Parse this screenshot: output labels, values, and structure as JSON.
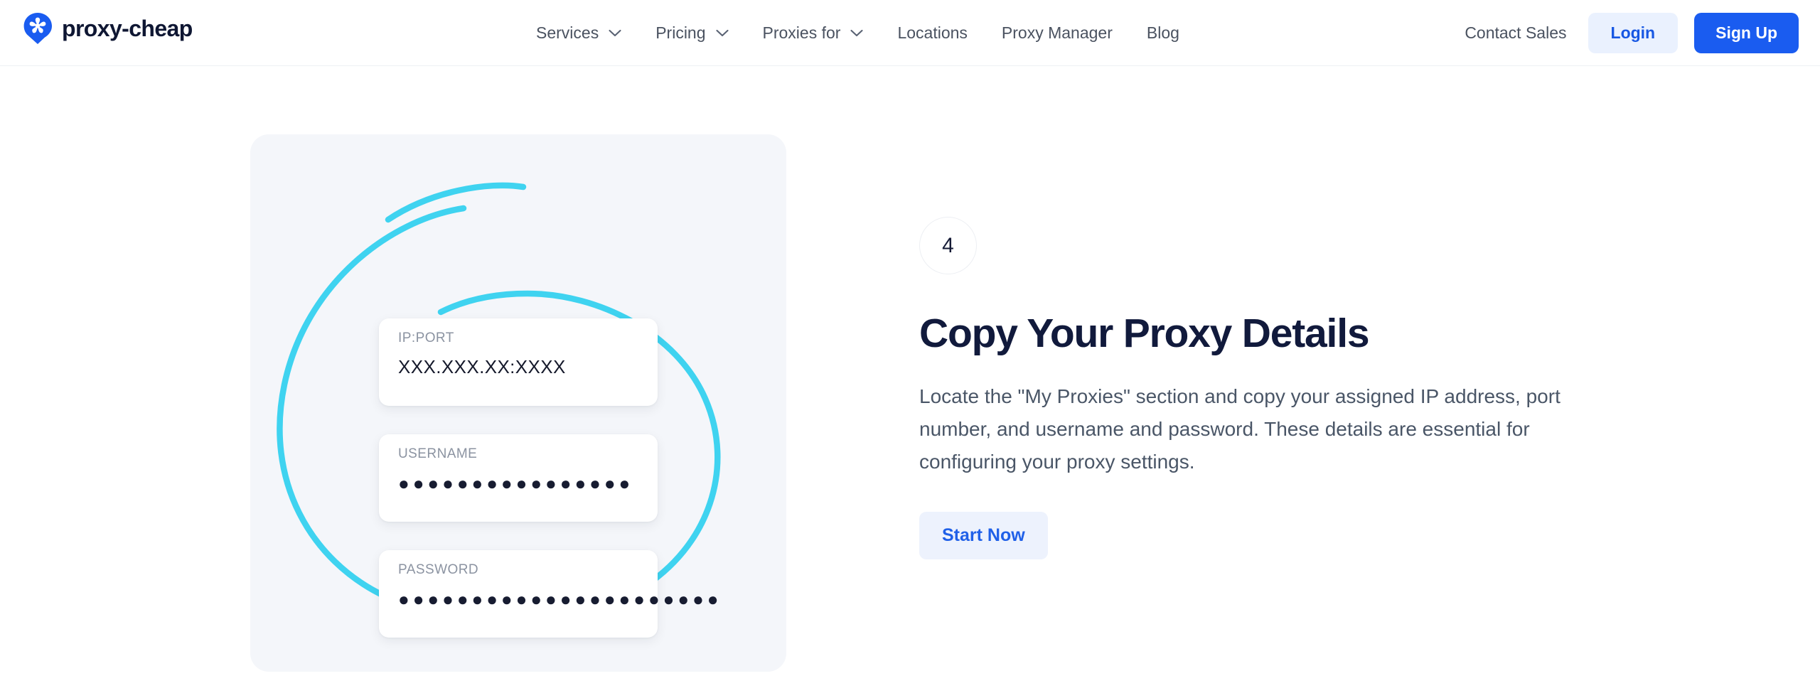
{
  "header": {
    "brand": {
      "name": "proxy-cheap",
      "logo_icon": "proxy-cheap-pin-logo-icon",
      "color": "#1a5cf0"
    },
    "nav_items": [
      {
        "label": "Services",
        "has_dropdown": true,
        "icon": "chevron-down-icon"
      },
      {
        "label": "Pricing",
        "has_dropdown": true,
        "icon": "chevron-down-icon"
      },
      {
        "label": "Proxies for",
        "has_dropdown": true,
        "icon": "chevron-down-icon"
      },
      {
        "label": "Locations",
        "has_dropdown": false,
        "icon": ""
      },
      {
        "label": "Proxy Manager",
        "has_dropdown": false,
        "icon": ""
      },
      {
        "label": "Blog",
        "has_dropdown": false,
        "icon": ""
      }
    ],
    "contact_sales_label": "Contact Sales",
    "login_label": "Login",
    "signup_label": "Sign Up",
    "login_color": "#1757e3",
    "login_bg": "#eaf1fe",
    "signup_bg": "#1a5cf0",
    "signup_color": "#ffffff"
  },
  "illustration": {
    "panel_bg": "#f4f6fa",
    "highlight_color": "#3fd3f0",
    "annotation_icon": "hand-drawn-ellipse-highlight-icon",
    "cards": [
      {
        "label": "IP:PORT",
        "value": "XXX.XXX.XX:XXXX",
        "masked": false
      },
      {
        "label": "USERNAME",
        "value": "●●●●●●●●●●●●●●●●",
        "masked": true
      },
      {
        "label": "PASSWORD",
        "value": "●●●●●●●●●●●●●●●●●●●●●●",
        "masked": true
      }
    ]
  },
  "content": {
    "step_number": "4",
    "title": "Copy Your Proxy Details",
    "body": "Locate the \"My Proxies\" section and copy your assigned IP address, port number, and username and password. These details are essential for configuring your proxy settings.",
    "cta_label": "Start Now",
    "cta_color": "#2060e8",
    "cta_bg": "#edf2fd"
  }
}
